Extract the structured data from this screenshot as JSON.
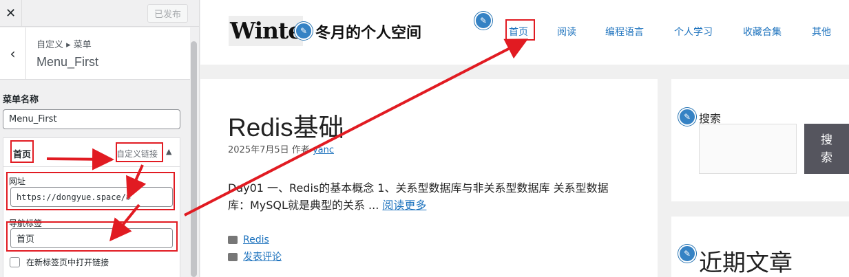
{
  "customizer": {
    "close_glyph": "✕",
    "publish_label": "已发布",
    "back_glyph": "‹",
    "breadcrumb": "自定义 ▸ 菜单",
    "panel_title": "Menu_First",
    "menu_name_label": "菜单名称",
    "menu_name_value": "Menu_First",
    "item": {
      "title": "首页",
      "type": "自定义链接",
      "toggle_glyph": "▲",
      "url_label": "网址",
      "url_value": "https://dongyue.space/#",
      "nav_label_label": "导航标签",
      "nav_label_value": "首页",
      "new_tab_label": "在新标签页中打开链接"
    }
  },
  "site": {
    "logo_text": "Winte",
    "site_name": "冬月的个人空间",
    "nav": [
      "首页",
      "阅读",
      "编程语言",
      "个人学习",
      "收藏合集",
      "其他"
    ],
    "post": {
      "title": "Redis基础",
      "date": "2025年7月5日",
      "author_prefix": "作者",
      "author": "yanc",
      "excerpt": "Day01 一、Redis的基本概念 1、关系型数据库与非关系型数据库 关系型数据库：MySQL就是典型的关系 ...",
      "read_more": "阅读更多",
      "category": "Redis",
      "comment": "发表评论"
    },
    "search_widget_title": "搜索",
    "search_button": "搜 索",
    "recent_title": "近期文章"
  },
  "icons": {
    "edit": "pencil-icon",
    "folder": "folder-icon",
    "comment": "comment-icon"
  },
  "colors": {
    "accent_blue": "#1e73be",
    "annotation_red": "#e11b22",
    "edit_button": "#3582c4"
  }
}
